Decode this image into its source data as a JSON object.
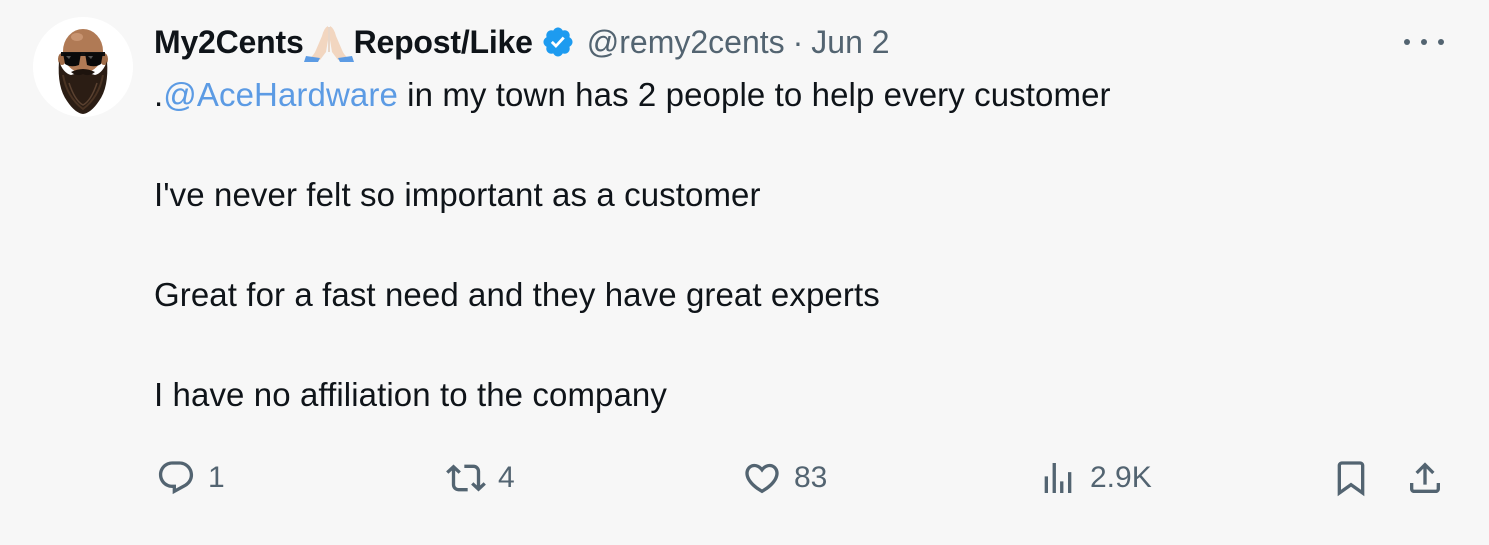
{
  "tweet": {
    "display_name": "My2Cents",
    "display_name_suffix": "Repost/Like",
    "emoji_icon": "folded-hands-emoji",
    "verified_icon": "verified-badge-icon",
    "handle": "@remy2cents",
    "separator": "·",
    "date": "Jun 2",
    "lines": [
      {
        "prefix": ".",
        "mention": "@AceHardware",
        "rest": " in my town has 2 people to help every customer"
      },
      {
        "text": "I've never felt so important as a customer"
      },
      {
        "text": "Great for a fast need and they have great experts"
      },
      {
        "text": "I have no affiliation to the company"
      }
    ]
  },
  "actions": {
    "reply": {
      "icon": "reply-icon",
      "count": "1"
    },
    "repost": {
      "icon": "repost-icon",
      "count": "4"
    },
    "like": {
      "icon": "heart-icon",
      "count": "83"
    },
    "views": {
      "icon": "views-icon",
      "count": "2.9K"
    },
    "bookmark": {
      "icon": "bookmark-icon"
    },
    "share": {
      "icon": "share-icon"
    }
  },
  "colors": {
    "background": "#f7f7f7",
    "text": "#0f1419",
    "muted": "#536471",
    "mention": "#5c9be4",
    "verified": "#1d9bf0"
  }
}
